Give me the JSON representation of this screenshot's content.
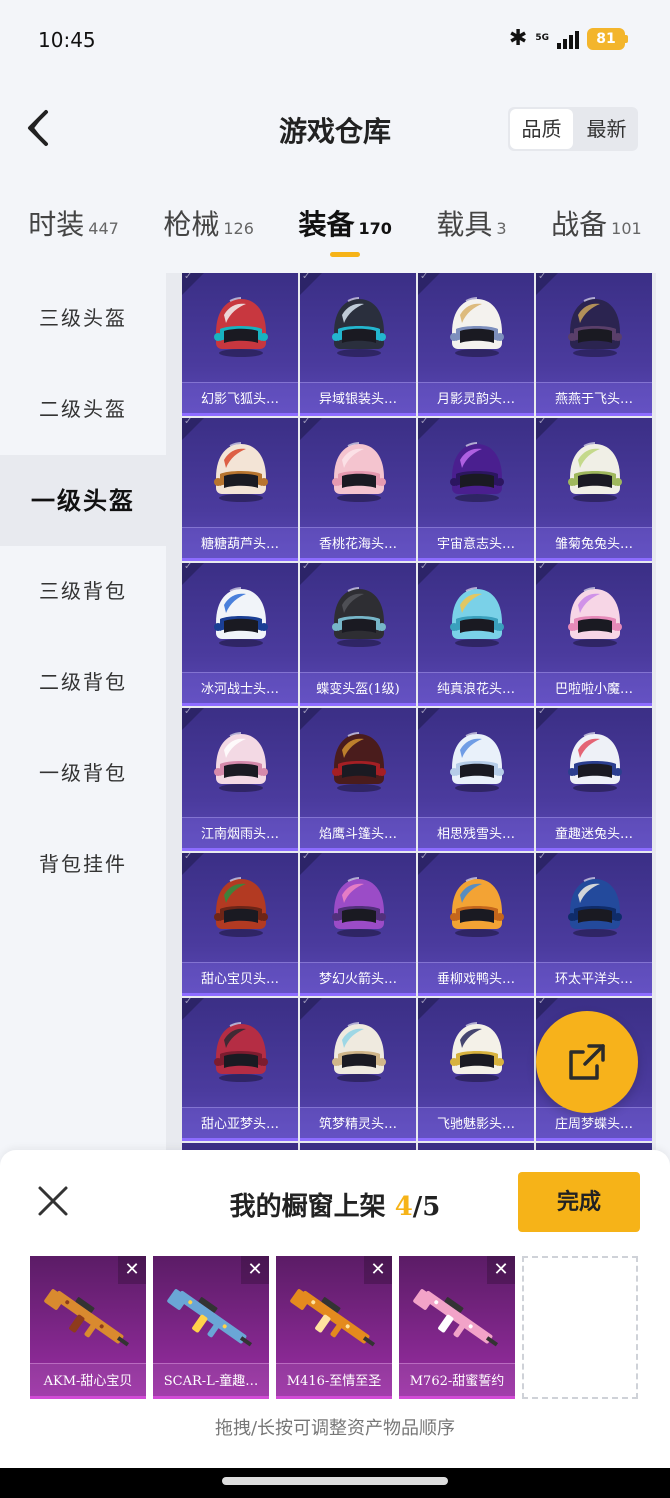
{
  "status": {
    "time": "10:45",
    "network": "5G",
    "battery": "81"
  },
  "header": {
    "title": "游戏仓库",
    "sort_quality": "品质",
    "sort_latest": "最新"
  },
  "tabs": [
    {
      "label": "时装",
      "count": "447"
    },
    {
      "label": "枪械",
      "count": "126"
    },
    {
      "label": "装备",
      "count": "170"
    },
    {
      "label": "载具",
      "count": "3"
    },
    {
      "label": "战备",
      "count": "101"
    }
  ],
  "active_tab": 2,
  "categories": [
    "三级头盔",
    "二级头盔",
    "一级头盔",
    "三级背包",
    "二级背包",
    "一级背包",
    "背包挂件"
  ],
  "active_category": 2,
  "items": [
    {
      "name": "幻影飞狐头…",
      "base": "#c8373f",
      "accent": "#f2f2f2",
      "rim": "#18b3c0"
    },
    {
      "name": "异域银装头…",
      "base": "#2a2f3d",
      "accent": "#d9e6f3",
      "rim": "#23b6cf"
    },
    {
      "name": "月影灵韵头…",
      "base": "#f4f2ee",
      "accent": "#d8b26a",
      "rim": "#7d8fbd"
    },
    {
      "name": "燕燕于飞头…",
      "base": "#2b2450",
      "accent": "#c9a35b",
      "rim": "#5a3f6a"
    },
    {
      "name": "糖糖葫芦头…",
      "base": "#f3e4d6",
      "accent": "#d8482c",
      "rim": "#b7742f"
    },
    {
      "name": "香桃花海头…",
      "base": "#f4c4cf",
      "accent": "#fbe5ea",
      "rim": "#e69ab0"
    },
    {
      "name": "宇宙意志头…",
      "base": "#4a1f8f",
      "accent": "#c06cf0",
      "rim": "#2c1660"
    },
    {
      "name": "雏菊兔兔头…",
      "base": "#f0efe6",
      "accent": "#bcd57a",
      "rim": "#9fb85d"
    },
    {
      "name": "冰河战士头…",
      "base": "#f1f4f9",
      "accent": "#2d6bd6",
      "rim": "#1b3f95"
    },
    {
      "name": "蝶变头盔(1级)",
      "base": "#2e2e33",
      "accent": "#54555c",
      "rim": "#77b6c9"
    },
    {
      "name": "纯真浪花头…",
      "base": "#7ad1e8",
      "accent": "#f3c64b",
      "rim": "#3aa0bd"
    },
    {
      "name": "巴啦啦小魔…",
      "base": "#f7d6e6",
      "accent": "#c986e7",
      "rim": "#e68ab9"
    },
    {
      "name": "江南烟雨头…",
      "base": "#f3d9e4",
      "accent": "#ffffff",
      "rim": "#d58aab"
    },
    {
      "name": "焰鹰斗篷头…",
      "base": "#4a1c1c",
      "accent": "#d0912f",
      "rim": "#a51f24"
    },
    {
      "name": "相思残雪头…",
      "base": "#e9f1fa",
      "accent": "#5a8ee0",
      "rim": "#b6cde8"
    },
    {
      "name": "童趣迷兔头…",
      "base": "#eef1f7",
      "accent": "#e24b5d",
      "rim": "#2b3f8f"
    },
    {
      "name": "甜心宝贝头…",
      "base": "#b33a22",
      "accent": "#2c8f3f",
      "rim": "#6d2517"
    },
    {
      "name": "梦幻火箭头…",
      "base": "#9b4cc7",
      "accent": "#f285c5",
      "rim": "#51307a"
    },
    {
      "name": "垂柳戏鸭头…",
      "base": "#f3a334",
      "accent": "#3e89d8",
      "rim": "#c4661c"
    },
    {
      "name": "环太平洋头…",
      "base": "#234a9c",
      "accent": "#f2efe4",
      "rim": "#0f2c6a"
    },
    {
      "name": "甜心亚梦头…",
      "base": "#b52d44",
      "accent": "#2c2a31",
      "rim": "#7d1c2f"
    },
    {
      "name": "筑梦精灵头…",
      "base": "#efeadf",
      "accent": "#8fd3e6",
      "rim": "#d0b68a"
    },
    {
      "name": "飞驰魅影头…",
      "base": "#f4f1e8",
      "accent": "#27285a",
      "rim": "#d7b23f"
    },
    {
      "name": "庄周梦蝶头…",
      "base": "#2c2c4a",
      "accent": "#6aa0d8",
      "rim": "#111"
    }
  ],
  "showcase": {
    "title_prefix": "我的橱窗上架",
    "count_current": "4",
    "count_total": "/5",
    "done_label": "完成",
    "slots": [
      {
        "name": "AKM-甜心宝贝",
        "gun_color": "#d98a2f",
        "accent": "#8e3b1c"
      },
      {
        "name": "SCAR-L-童趣…",
        "gun_color": "#6aa6d6",
        "accent": "#ffd24a"
      },
      {
        "name": "M416-至情至圣",
        "gun_color": "#e48a1e",
        "accent": "#ffe3a0"
      },
      {
        "name": "M762-甜蜜誓约",
        "gun_color": "#f2a3c8",
        "accent": "#ffffff"
      }
    ],
    "hint": "拖拽/长按可调整资产物品顺序"
  },
  "colors": {
    "accent": "#f6b318",
    "card_bg": "#3b2f86",
    "showcase_bg": "#9b2ea5"
  }
}
